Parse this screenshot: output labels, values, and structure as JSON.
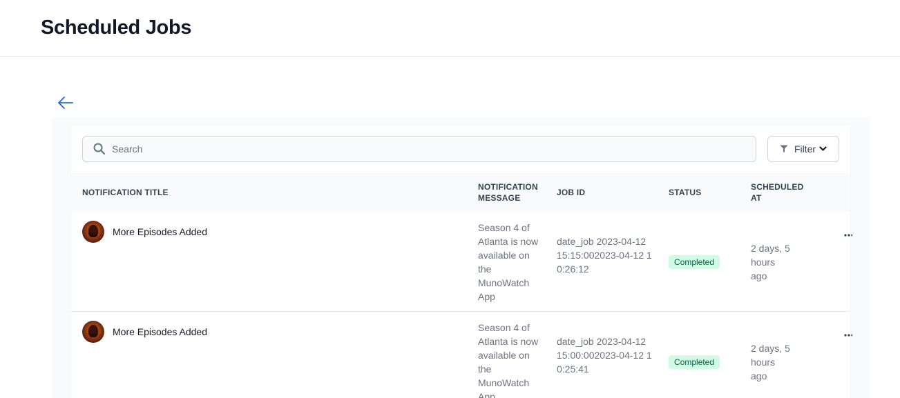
{
  "header": {
    "title": "Scheduled Jobs"
  },
  "search": {
    "placeholder": "Search"
  },
  "filter": {
    "label": "Filter"
  },
  "columns": {
    "title": "NOTIFICATION TITLE",
    "message": "NOTIFICATION MESSAGE",
    "job_id": "JOB ID",
    "status": "STATUS",
    "scheduled_at": "SCHEDULED AT"
  },
  "rows": [
    {
      "title": "More Episodes Added",
      "message": "Season 4 of Atlanta is now available on the MunoWatch App",
      "job_id": "date_job 2023-04-12 15:15:002023-04-12 10:26:12",
      "status": "Completed",
      "scheduled_at": "2 days, 5 hours ago"
    },
    {
      "title": "More Episodes Added",
      "message": "Season 4 of Atlanta is now available on the MunoWatch App",
      "job_id": "date_job 2023-04-12 15:00:002023-04-12 10:25:41",
      "status": "Completed",
      "scheduled_at": "2 days, 5 hours ago"
    }
  ]
}
